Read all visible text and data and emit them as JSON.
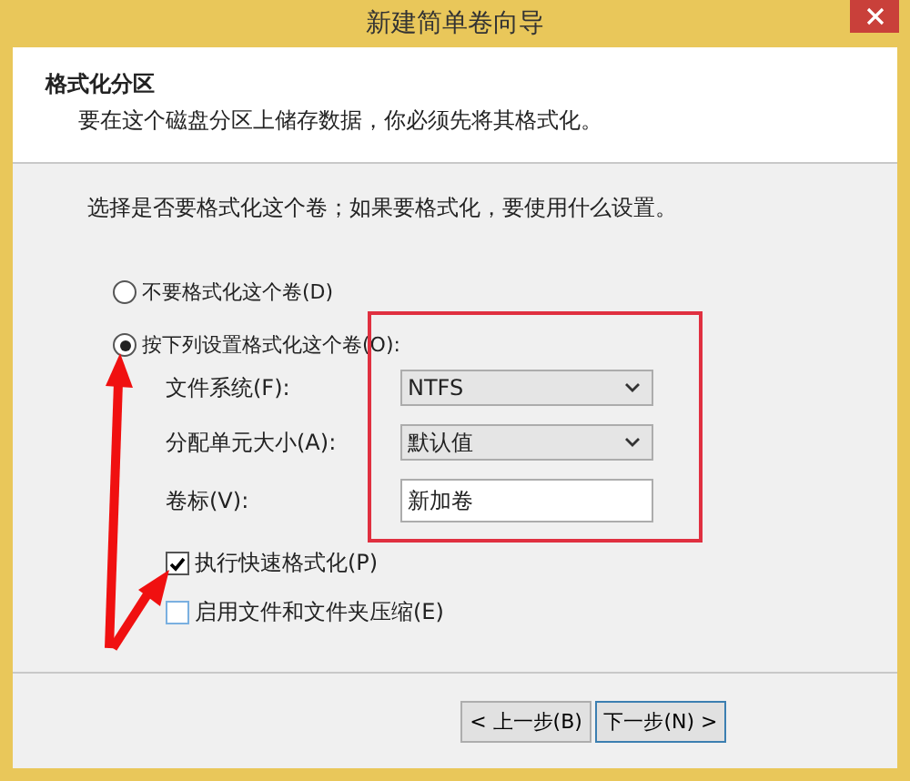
{
  "window": {
    "title": "新建简单卷向导"
  },
  "header": {
    "title": "格式化分区",
    "subtitle": "要在这个磁盘分区上储存数据，你必须先将其格式化。"
  },
  "instruction": "选择是否要格式化这个卷；如果要格式化，要使用什么设置。",
  "options": [
    {
      "label": "不要格式化这个卷(D)",
      "selected": false
    },
    {
      "label": "按下列设置格式化这个卷(O):",
      "selected": true
    }
  ],
  "settings": [
    {
      "kind": "dropdown",
      "label": "文件系统(F):",
      "value": "NTFS"
    },
    {
      "kind": "dropdown",
      "label": "分配单元大小(A):",
      "value": "默认值"
    },
    {
      "kind": "text",
      "label": "卷标(V):",
      "value": "新加卷"
    }
  ],
  "checkboxes": [
    {
      "label": "执行快速格式化(P)",
      "checked": true
    },
    {
      "label": "启用文件和文件夹压缩(E)",
      "checked": false
    }
  ],
  "buttons": [
    {
      "label": "< 上一步(B)",
      "default": false
    },
    {
      "label": "下一步(N) >",
      "default": true
    }
  ]
}
